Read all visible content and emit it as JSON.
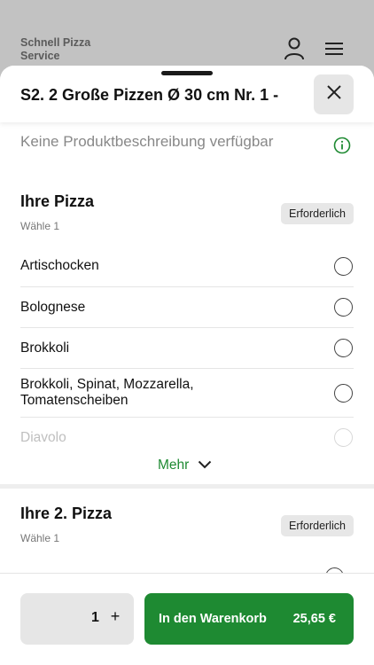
{
  "app": {
    "brand": "Schnell Pizza Service"
  },
  "header": {
    "user_icon": "user-icon",
    "menu_icon": "hamburger-menu-icon"
  },
  "product": {
    "title": "S2. 2 Große Pizzen Ø 30 cm Nr. 1 -",
    "description": "Keine Produktbeschreibung verfügbar"
  },
  "sections": [
    {
      "title": "Ihre Pizza",
      "subtitle": "Wähle 1",
      "badge": "Erforderlich",
      "options": [
        {
          "label": "Artischocken"
        },
        {
          "label": "Bolognese"
        },
        {
          "label": "Brokkoli"
        },
        {
          "label": "Brokkoli, Spinat, Mozzarella, Tomatenscheiben"
        },
        {
          "label": "Diavolo"
        }
      ],
      "more_label": "Mehr"
    },
    {
      "title": "Ihre 2. Pizza",
      "subtitle": "Wähle 1",
      "badge": "Erforderlich"
    }
  ],
  "footer": {
    "quantity": "1",
    "plus_label": "+",
    "cart_label": "In den Warenkorb",
    "price": "25,65 €"
  },
  "colors": {
    "accent": "#1e8a32",
    "sheet": "#ffffff",
    "backdrop": "#c2c2c2"
  }
}
